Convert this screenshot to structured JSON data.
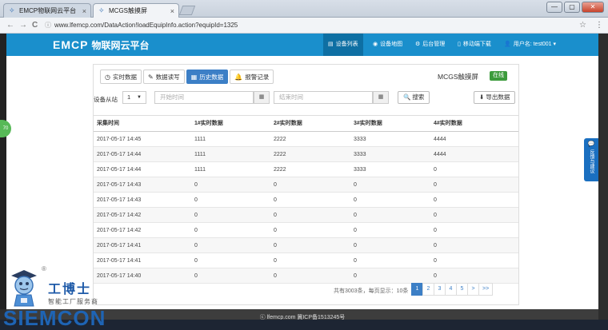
{
  "browser": {
    "tabs": [
      {
        "title": "EMCP物联网云平台",
        "active": false
      },
      {
        "title": "MCGS触摸屏",
        "active": true
      }
    ],
    "tab_close_glyph": "×",
    "url": "www.lfemcp.com/DataAction!loadEquipInfo.action?equipId=1325",
    "window_controls": [
      "—",
      "▢",
      "✕"
    ],
    "nav_glyphs": {
      "back": "←",
      "forward": "→",
      "reload": "C"
    },
    "star_glyph": "☆",
    "menu_glyph": "⋮"
  },
  "app_nav": {
    "logo_brand": "EMCP",
    "logo_title": "物联网云平台",
    "items": [
      {
        "label": "设备列表",
        "icon": "list-icon",
        "glyph": "▤",
        "active": true
      },
      {
        "label": "设备地图",
        "icon": "map-pin-icon",
        "glyph": "◉",
        "active": false
      },
      {
        "label": "后台管理",
        "icon": "cogs-icon",
        "glyph": "⚙",
        "active": false
      },
      {
        "label": "移动端下载",
        "icon": "mobile-icon",
        "glyph": "▯",
        "active": false
      },
      {
        "label": "用户名: test001 ▾",
        "icon": "user-icon",
        "glyph": "👤",
        "active": false
      }
    ]
  },
  "panel": {
    "tabs": [
      {
        "label": "实时数据",
        "icon": "clock-icon",
        "glyph": "◷",
        "active": false
      },
      {
        "label": "数据读写",
        "icon": "pencil-icon",
        "glyph": "✎",
        "active": false
      },
      {
        "label": "历史数据",
        "icon": "table-icon",
        "glyph": "▦",
        "active": true
      },
      {
        "label": "报警记录",
        "icon": "bell-icon",
        "glyph": "🔔",
        "active": false
      }
    ],
    "device_name": "MCGS触摸屏",
    "status_badge": "在线"
  },
  "filters": {
    "slave_label": "设备从站",
    "slave_value": "1",
    "slave_caret": "▼",
    "start_placeholder": "开始时间",
    "end_placeholder": "结束时间",
    "calendar_glyph": "▦",
    "search_label": "🔍 搜索",
    "export_label": "⬇ 导出数据"
  },
  "table": {
    "columns": [
      "采集时间",
      "1#实时数据",
      "2#实时数据",
      "3#实时数据",
      "4#实时数据"
    ],
    "rows": [
      [
        "2017-05-17 14:45",
        "1111",
        "2222",
        "3333",
        "4444"
      ],
      [
        "2017-05-17 14:44",
        "1111",
        "2222",
        "3333",
        "4444"
      ],
      [
        "2017-05-17 14:44",
        "1111",
        "2222",
        "3333",
        "0"
      ],
      [
        "2017-05-17 14:43",
        "0",
        "0",
        "0",
        "0"
      ],
      [
        "2017-05-17 14:43",
        "0",
        "0",
        "0",
        "0"
      ],
      [
        "2017-05-17 14:42",
        "0",
        "0",
        "0",
        "0"
      ],
      [
        "2017-05-17 14:42",
        "0",
        "0",
        "0",
        "0"
      ],
      [
        "2017-05-17 14:41",
        "0",
        "0",
        "0",
        "0"
      ],
      [
        "2017-05-17 14:41",
        "0",
        "0",
        "0",
        "0"
      ],
      [
        "2017-05-17 14:40",
        "0",
        "0",
        "0",
        "0"
      ]
    ]
  },
  "pagination": {
    "info": "共有3003条，每页显示：10条",
    "pages": [
      "1",
      "2",
      "3",
      "4",
      "5",
      ">",
      ">>"
    ],
    "current": "1"
  },
  "feedback": {
    "label": "反馈与建议",
    "glyph": "💬"
  },
  "side_bubble": "70",
  "footer": {
    "text": "ⓒ lfemcp.com 冀ICP备1513245号"
  },
  "watermark": {
    "reg": "®",
    "zh": "工博士",
    "sub": "智能工厂服务商",
    "brand": "SIEMCON"
  },
  "colors": {
    "nav_bg": "#1a8fcc",
    "accent": "#3c7fc6",
    "online": "#3c9b3c"
  }
}
